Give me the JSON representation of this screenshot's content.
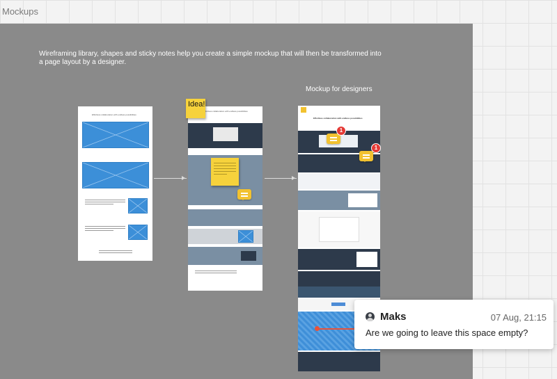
{
  "frame": {
    "title": "Mockups"
  },
  "intro_text": "Wireframing library, shapes and sticky notes help you create a simple mockup that will then be transformed into a page layout by a designer.",
  "mockup_label": "Mockup for designers",
  "sticky_idea": "Idea!",
  "wireframe_title": "Effortless collaboration with endless possibilities",
  "notification_badges": [
    "1",
    "1"
  ],
  "comment": {
    "author": "Maks",
    "time": "07 Aug, 21:15",
    "message": "Are we going to leave this space empty?"
  },
  "colors": {
    "frame_bg": "#8a8a8a",
    "sticky": "#f6d23c",
    "placeholder_blue": "#3c8fd8",
    "dark_band": "#2d3a4b",
    "slate_band": "#7a8fa3",
    "badge": "#e53935"
  }
}
